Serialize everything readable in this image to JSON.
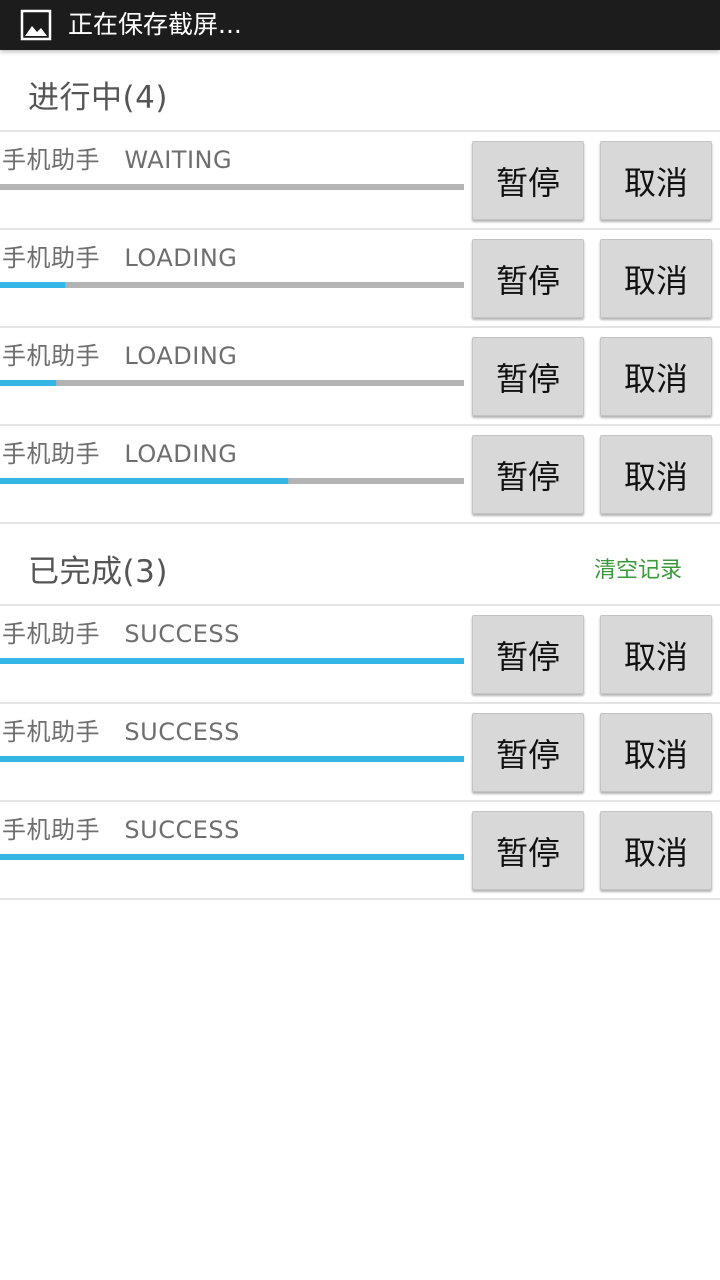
{
  "status_bar": {
    "icon": "image-icon",
    "text": "正在保存截屏..."
  },
  "in_progress": {
    "title": "进行中(4)",
    "tasks": [
      {
        "name": "手机助手",
        "status": "WAITING",
        "progress": 0.0,
        "pause_label": "暂停",
        "cancel_label": "取消"
      },
      {
        "name": "手机助手",
        "status": "LOADING",
        "progress": 0.14,
        "pause_label": "暂停",
        "cancel_label": "取消"
      },
      {
        "name": "手机助手",
        "status": "LOADING",
        "progress": 0.12,
        "pause_label": "暂停",
        "cancel_label": "取消"
      },
      {
        "name": "手机助手",
        "status": "LOADING",
        "progress": 0.62,
        "pause_label": "暂停",
        "cancel_label": "取消"
      }
    ]
  },
  "completed": {
    "title": "已完成(3)",
    "clear_label": "清空记录",
    "tasks": [
      {
        "name": "手机助手",
        "status": "SUCCESS",
        "progress": 1.0,
        "pause_label": "暂停",
        "cancel_label": "取消"
      },
      {
        "name": "手机助手",
        "status": "SUCCESS",
        "progress": 1.0,
        "pause_label": "暂停",
        "cancel_label": "取消"
      },
      {
        "name": "手机助手",
        "status": "SUCCESS",
        "progress": 1.0,
        "pause_label": "暂停",
        "cancel_label": "取消"
      }
    ]
  },
  "colors": {
    "progress_fill": "#33b5e5",
    "progress_track": "#b4b4b4",
    "clear_link": "#3a9a3a",
    "status_bar_bg": "#1c1c1c"
  }
}
